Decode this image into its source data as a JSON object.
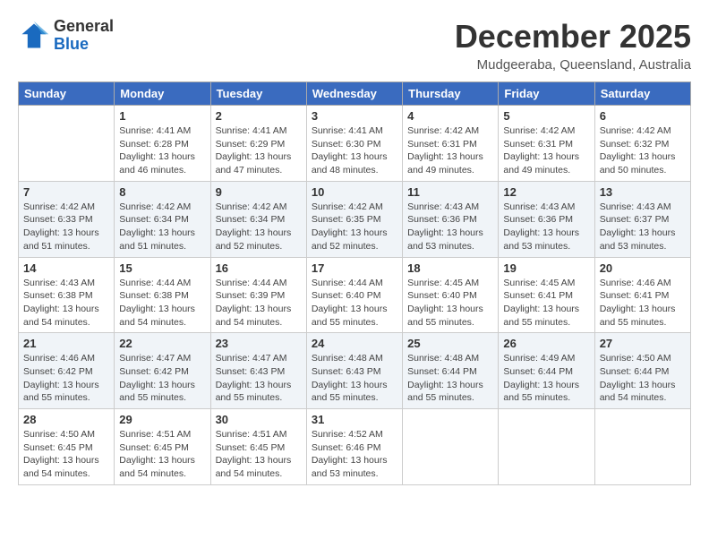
{
  "header": {
    "logo_general": "General",
    "logo_blue": "Blue",
    "month_title": "December 2025",
    "location": "Mudgeeraba, Queensland, Australia"
  },
  "weekdays": [
    "Sunday",
    "Monday",
    "Tuesday",
    "Wednesday",
    "Thursday",
    "Friday",
    "Saturday"
  ],
  "weeks": [
    [
      {
        "day": "",
        "info": ""
      },
      {
        "day": "1",
        "info": "Sunrise: 4:41 AM\nSunset: 6:28 PM\nDaylight: 13 hours\nand 46 minutes."
      },
      {
        "day": "2",
        "info": "Sunrise: 4:41 AM\nSunset: 6:29 PM\nDaylight: 13 hours\nand 47 minutes."
      },
      {
        "day": "3",
        "info": "Sunrise: 4:41 AM\nSunset: 6:30 PM\nDaylight: 13 hours\nand 48 minutes."
      },
      {
        "day": "4",
        "info": "Sunrise: 4:42 AM\nSunset: 6:31 PM\nDaylight: 13 hours\nand 49 minutes."
      },
      {
        "day": "5",
        "info": "Sunrise: 4:42 AM\nSunset: 6:31 PM\nDaylight: 13 hours\nand 49 minutes."
      },
      {
        "day": "6",
        "info": "Sunrise: 4:42 AM\nSunset: 6:32 PM\nDaylight: 13 hours\nand 50 minutes."
      }
    ],
    [
      {
        "day": "7",
        "info": "Sunrise: 4:42 AM\nSunset: 6:33 PM\nDaylight: 13 hours\nand 51 minutes."
      },
      {
        "day": "8",
        "info": "Sunrise: 4:42 AM\nSunset: 6:34 PM\nDaylight: 13 hours\nand 51 minutes."
      },
      {
        "day": "9",
        "info": "Sunrise: 4:42 AM\nSunset: 6:34 PM\nDaylight: 13 hours\nand 52 minutes."
      },
      {
        "day": "10",
        "info": "Sunrise: 4:42 AM\nSunset: 6:35 PM\nDaylight: 13 hours\nand 52 minutes."
      },
      {
        "day": "11",
        "info": "Sunrise: 4:43 AM\nSunset: 6:36 PM\nDaylight: 13 hours\nand 53 minutes."
      },
      {
        "day": "12",
        "info": "Sunrise: 4:43 AM\nSunset: 6:36 PM\nDaylight: 13 hours\nand 53 minutes."
      },
      {
        "day": "13",
        "info": "Sunrise: 4:43 AM\nSunset: 6:37 PM\nDaylight: 13 hours\nand 53 minutes."
      }
    ],
    [
      {
        "day": "14",
        "info": "Sunrise: 4:43 AM\nSunset: 6:38 PM\nDaylight: 13 hours\nand 54 minutes."
      },
      {
        "day": "15",
        "info": "Sunrise: 4:44 AM\nSunset: 6:38 PM\nDaylight: 13 hours\nand 54 minutes."
      },
      {
        "day": "16",
        "info": "Sunrise: 4:44 AM\nSunset: 6:39 PM\nDaylight: 13 hours\nand 54 minutes."
      },
      {
        "day": "17",
        "info": "Sunrise: 4:44 AM\nSunset: 6:40 PM\nDaylight: 13 hours\nand 55 minutes."
      },
      {
        "day": "18",
        "info": "Sunrise: 4:45 AM\nSunset: 6:40 PM\nDaylight: 13 hours\nand 55 minutes."
      },
      {
        "day": "19",
        "info": "Sunrise: 4:45 AM\nSunset: 6:41 PM\nDaylight: 13 hours\nand 55 minutes."
      },
      {
        "day": "20",
        "info": "Sunrise: 4:46 AM\nSunset: 6:41 PM\nDaylight: 13 hours\nand 55 minutes."
      }
    ],
    [
      {
        "day": "21",
        "info": "Sunrise: 4:46 AM\nSunset: 6:42 PM\nDaylight: 13 hours\nand 55 minutes."
      },
      {
        "day": "22",
        "info": "Sunrise: 4:47 AM\nSunset: 6:42 PM\nDaylight: 13 hours\nand 55 minutes."
      },
      {
        "day": "23",
        "info": "Sunrise: 4:47 AM\nSunset: 6:43 PM\nDaylight: 13 hours\nand 55 minutes."
      },
      {
        "day": "24",
        "info": "Sunrise: 4:48 AM\nSunset: 6:43 PM\nDaylight: 13 hours\nand 55 minutes."
      },
      {
        "day": "25",
        "info": "Sunrise: 4:48 AM\nSunset: 6:44 PM\nDaylight: 13 hours\nand 55 minutes."
      },
      {
        "day": "26",
        "info": "Sunrise: 4:49 AM\nSunset: 6:44 PM\nDaylight: 13 hours\nand 55 minutes."
      },
      {
        "day": "27",
        "info": "Sunrise: 4:50 AM\nSunset: 6:44 PM\nDaylight: 13 hours\nand 54 minutes."
      }
    ],
    [
      {
        "day": "28",
        "info": "Sunrise: 4:50 AM\nSunset: 6:45 PM\nDaylight: 13 hours\nand 54 minutes."
      },
      {
        "day": "29",
        "info": "Sunrise: 4:51 AM\nSunset: 6:45 PM\nDaylight: 13 hours\nand 54 minutes."
      },
      {
        "day": "30",
        "info": "Sunrise: 4:51 AM\nSunset: 6:45 PM\nDaylight: 13 hours\nand 54 minutes."
      },
      {
        "day": "31",
        "info": "Sunrise: 4:52 AM\nSunset: 6:46 PM\nDaylight: 13 hours\nand 53 minutes."
      },
      {
        "day": "",
        "info": ""
      },
      {
        "day": "",
        "info": ""
      },
      {
        "day": "",
        "info": ""
      }
    ]
  ]
}
